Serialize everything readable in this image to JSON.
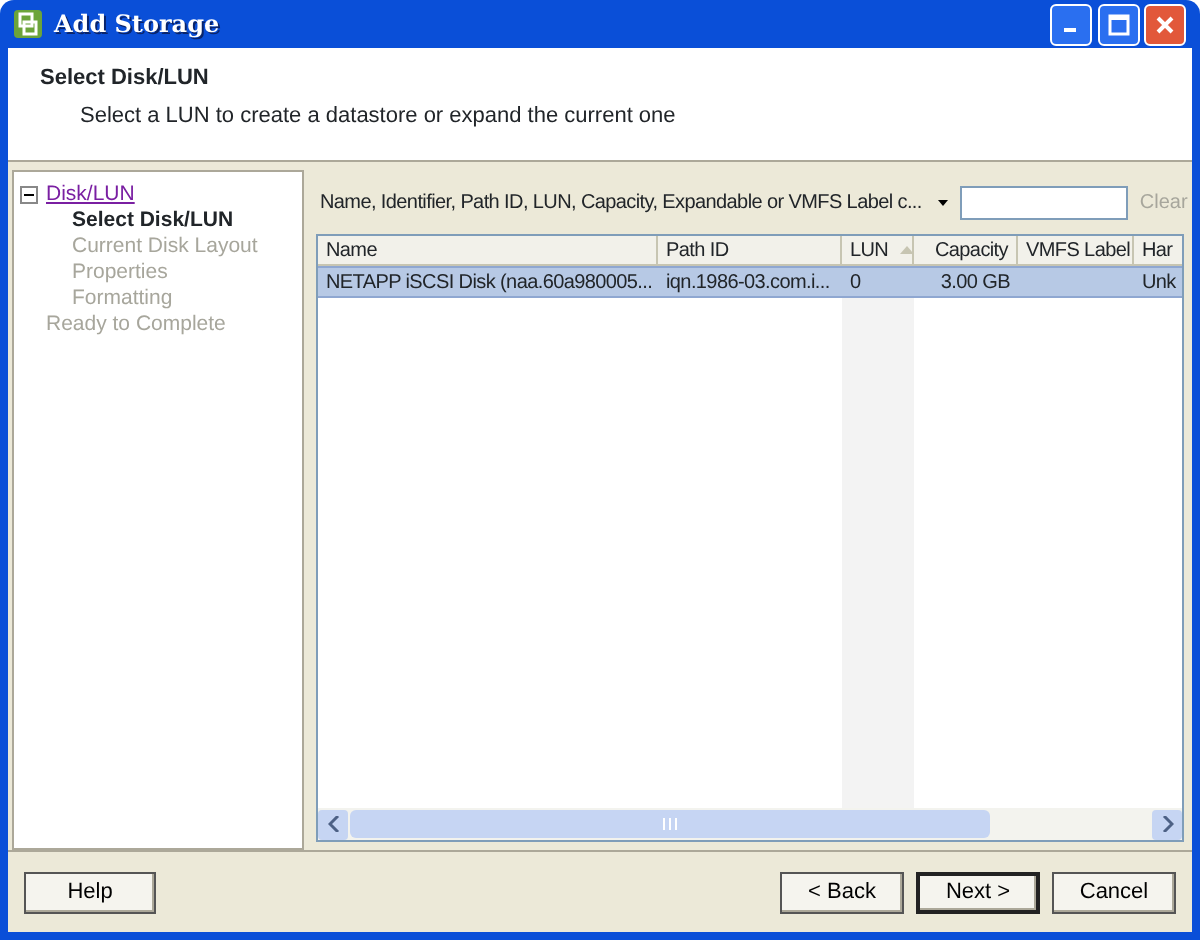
{
  "window": {
    "title": "Add Storage"
  },
  "header": {
    "title": "Select Disk/LUN",
    "subtitle": "Select a LUN to create a datastore or expand the current one"
  },
  "steps": [
    {
      "label": "Disk/LUN",
      "kind": "link",
      "expanded": true,
      "children": [
        {
          "label": "Select Disk/LUN",
          "selected": true,
          "disabled": false
        },
        {
          "label": "Current Disk Layout",
          "selected": false,
          "disabled": true
        },
        {
          "label": "Properties",
          "selected": false,
          "disabled": true
        },
        {
          "label": "Formatting",
          "selected": false,
          "disabled": true
        }
      ]
    },
    {
      "label": "Ready to Complete",
      "kind": "plain",
      "disabled": true
    }
  ],
  "filter": {
    "field": "Name, Identifier, Path ID, LUN, Capacity, Expandable or VMFS Label c...",
    "clear": "Clear",
    "clear_disabled": true
  },
  "table": {
    "columns": [
      {
        "label": "Name",
        "kind": "text",
        "sorted": false
      },
      {
        "label": "Path ID",
        "kind": "text",
        "sorted": false
      },
      {
        "label": "LUN",
        "kind": "text",
        "sorted": true
      },
      {
        "label": "Capacity",
        "kind": "number",
        "sorted": false
      },
      {
        "label": "VMFS Label",
        "kind": "text",
        "sorted": false
      },
      {
        "label": "Har",
        "kind": "text",
        "sorted": false
      }
    ],
    "rows": [
      {
        "selected": true,
        "cells": [
          "NETAPP iSCSI Disk (naa.60a980005...",
          "iqn.1986-03.com.i...",
          "0",
          "3.00 GB",
          "",
          "Unk"
        ]
      }
    ]
  },
  "buttons": [
    {
      "label": "Help",
      "kind": "help",
      "default": false
    },
    {
      "label": "< Back",
      "kind": "nav",
      "default": false
    },
    {
      "label": "Next >",
      "kind": "nav",
      "default": true
    },
    {
      "label": "Cancel",
      "kind": "nav",
      "default": false
    }
  ]
}
